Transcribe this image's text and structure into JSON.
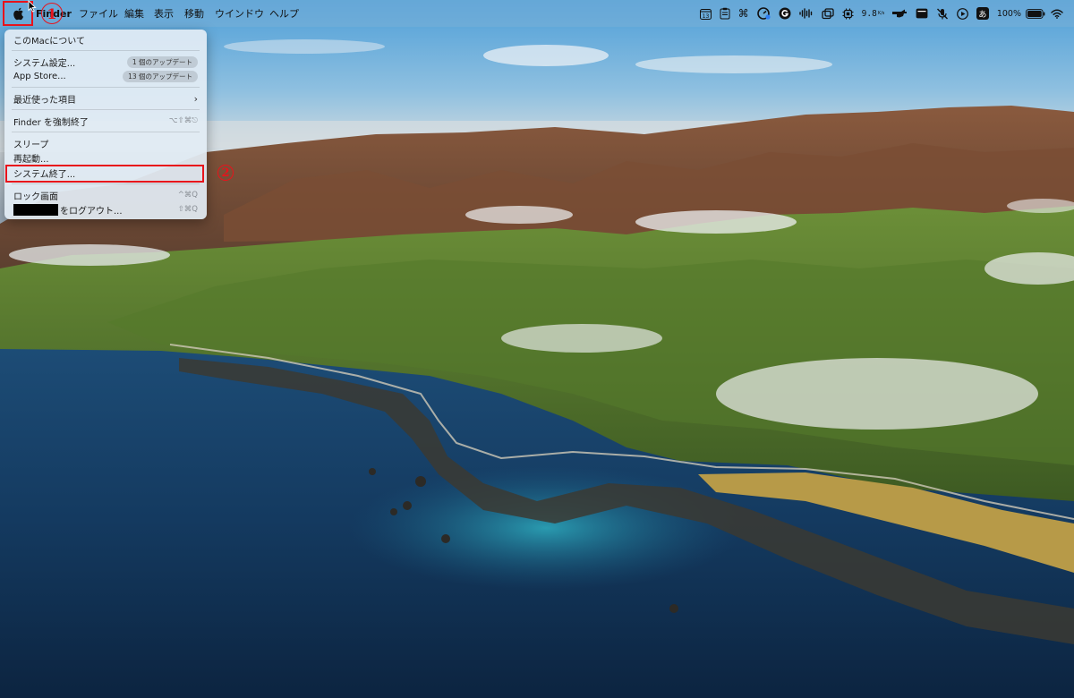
{
  "menubar": {
    "app_name": "Finder",
    "menus": [
      "ファイル",
      "編集",
      "表示",
      "移動",
      "ウインドウ",
      "ヘルプ"
    ],
    "status": {
      "calendar_day": "13",
      "network_speed": "9.8",
      "network_unit": "K/s",
      "input_method": "あ",
      "battery": "100%"
    }
  },
  "apple_menu": {
    "about": "このMacについて",
    "system_settings": "システム設定...",
    "system_settings_badge": "1 個のアップデート",
    "app_store": "App Store...",
    "app_store_badge": "13 個のアップデート",
    "recent_items": "最近使った項目",
    "force_quit": "Finder を強制終了",
    "force_quit_shortcut": "⌥⇧⌘⎋",
    "sleep": "スリープ",
    "restart": "再起動...",
    "shutdown": "システム終了...",
    "lock_screen": "ロック画面",
    "lock_screen_shortcut": "^⌘Q",
    "logout": "をログアウト...",
    "logout_shortcut": "⇧⌘Q"
  },
  "annotations": {
    "step1": "1",
    "step2": "2"
  },
  "colors": {
    "highlight": "#e8131b",
    "menubar": "#78afd7"
  }
}
